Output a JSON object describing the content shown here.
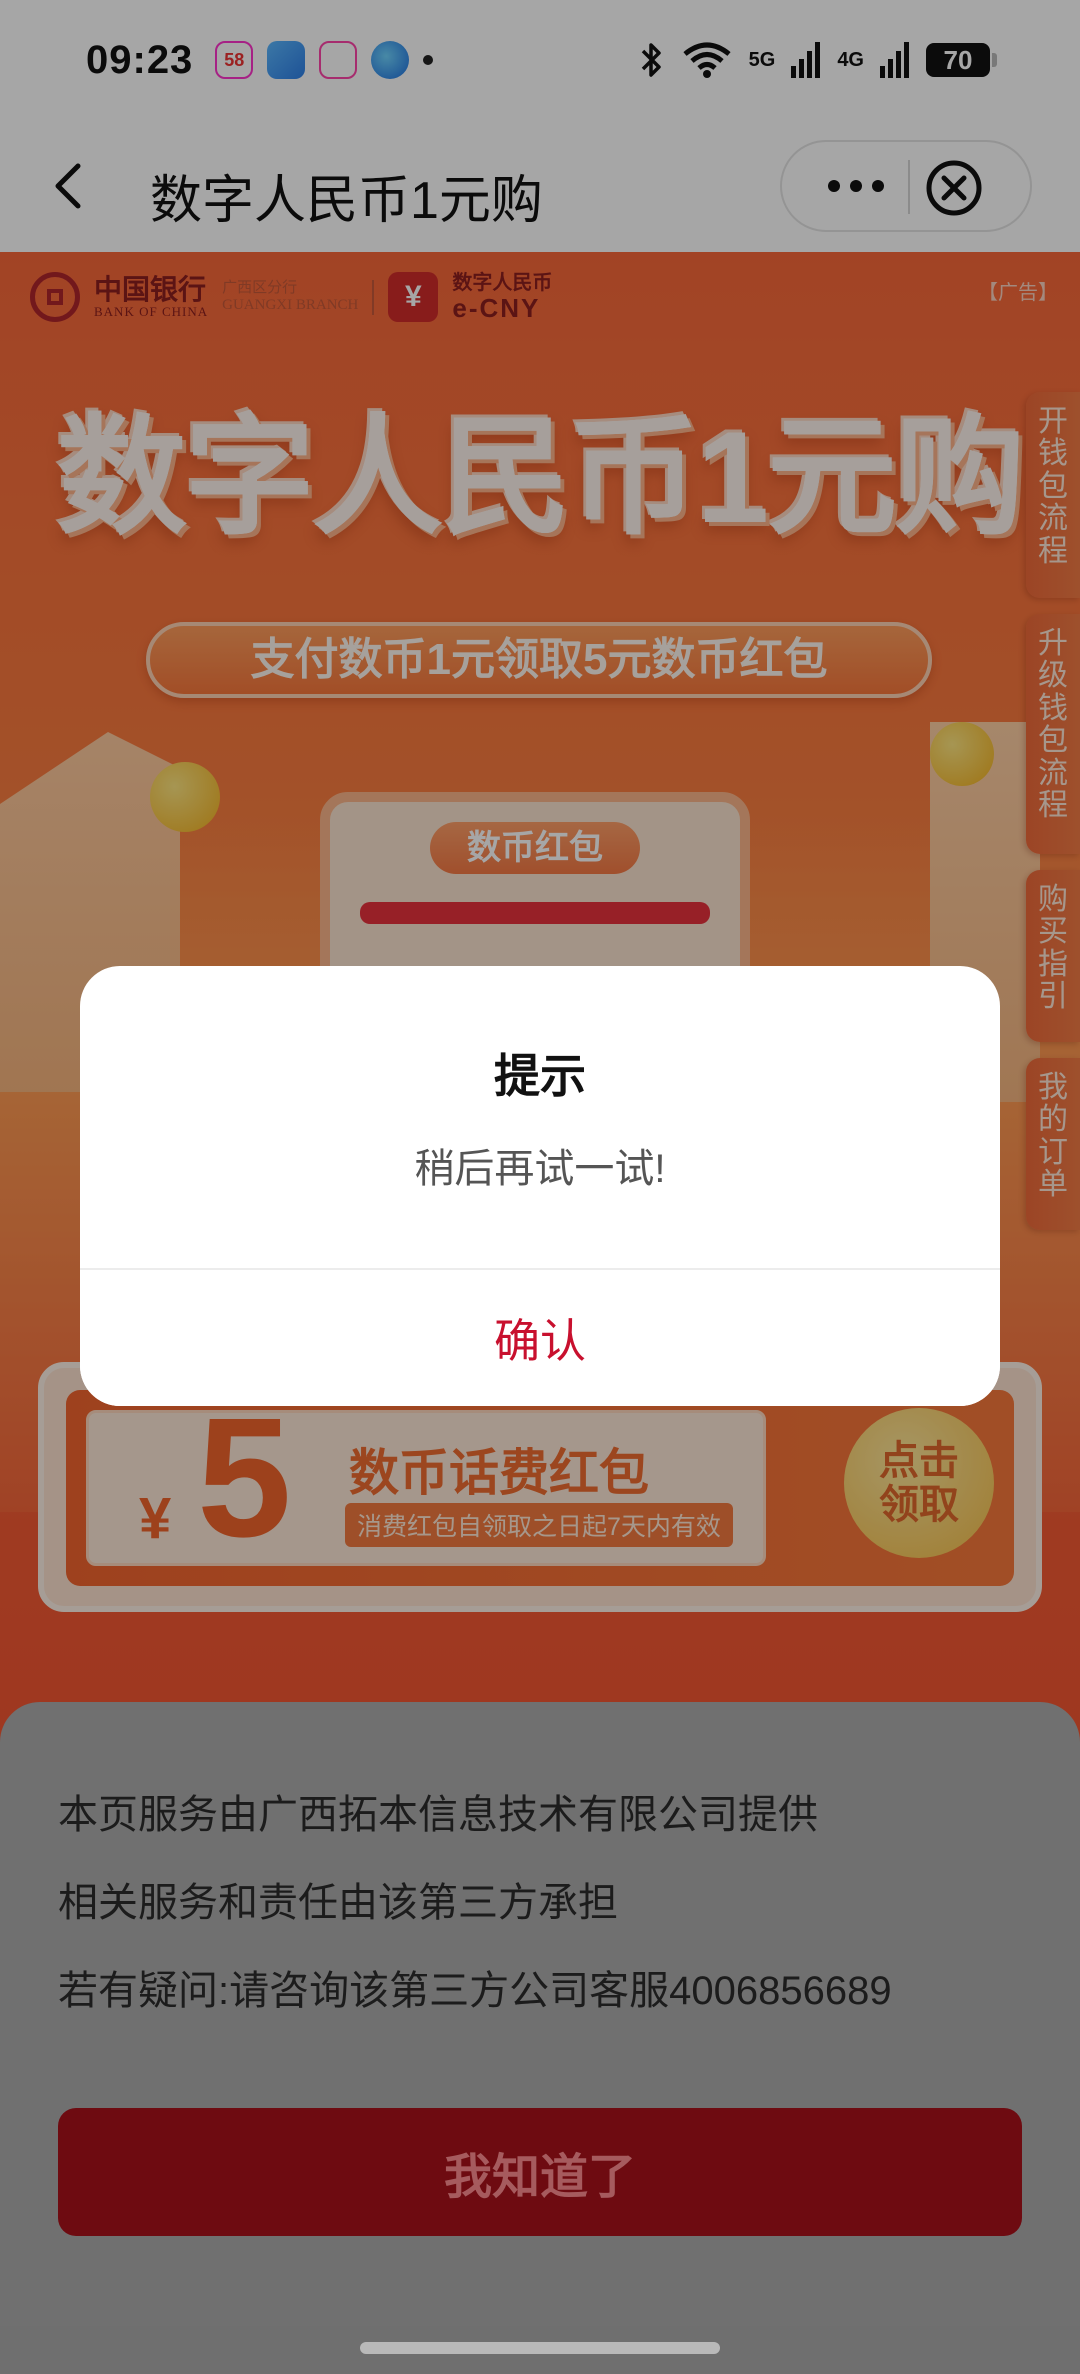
{
  "status_bar": {
    "time": "09:23",
    "notification_icons": [
      "58-app-icon",
      "weather-icon",
      "app-icon",
      "browser-icon"
    ],
    "signal_5g": "5G",
    "signal_4g": "4G",
    "battery": "70"
  },
  "title_bar": {
    "title": "数字人民币1元购"
  },
  "promo": {
    "bank_name_cn": "中国银行",
    "bank_name_en": "BANK OF CHINA",
    "branch_cn": "广西区分行",
    "branch_en": "GUANGXI BRANCH",
    "ecny_cn": "数字人民币",
    "ecny_en": "e-CNY",
    "ad_label": "【广告】",
    "headline": "数字人民币1元购",
    "subhead": "支付数币1元领取5元数币红包",
    "side_tabs": [
      "开钱包流程",
      "升级钱包流程",
      "购买指引",
      "我的订单"
    ],
    "card_label": "数币红包",
    "coupon": {
      "currency": "¥",
      "amount": "5",
      "title": "数币话费红包",
      "note": "消费红包自领取之日起7天内有效",
      "button_line1": "点击",
      "button_line2": "领取"
    }
  },
  "dialog": {
    "title": "提示",
    "message": "稍后再试一试!",
    "confirm": "确认"
  },
  "sheet": {
    "line1": "本页服务由广西拓本信息技术有限公司提供",
    "line2": "相关服务和责任由该第三方承担",
    "line3": "若有疑问:请咨询该第三方公司客服4006856689",
    "button": "我知道了"
  },
  "colors": {
    "accent_red": "#c8102e",
    "promo_orange": "#f9683a",
    "sheet_button": "#6e0b11"
  }
}
